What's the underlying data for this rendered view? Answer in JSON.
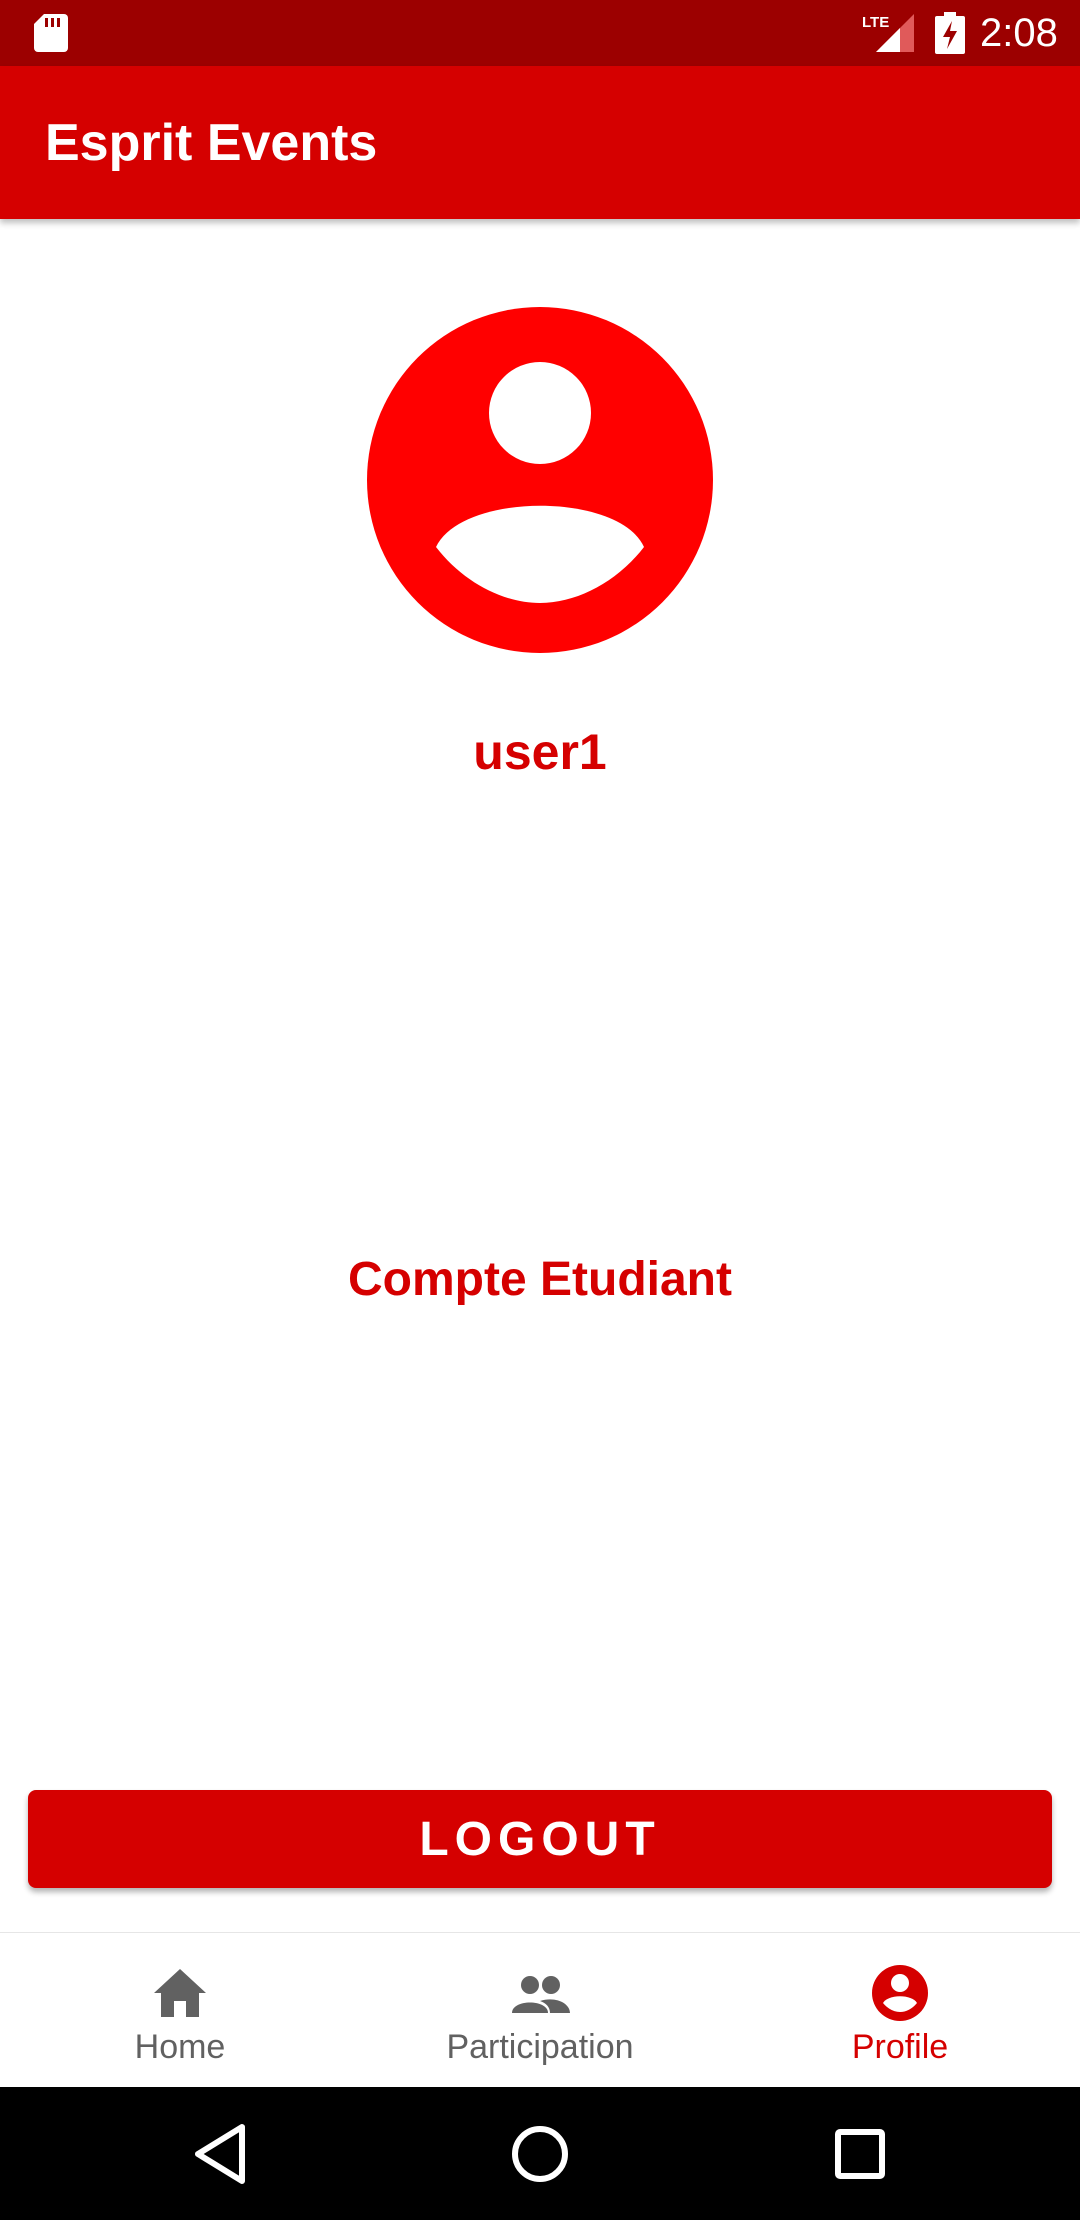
{
  "status_bar": {
    "time": "2:08",
    "network_label": "LTE",
    "icons": [
      "sd-card-icon",
      "lte-signal-icon",
      "battery-charging-icon"
    ]
  },
  "app_bar": {
    "title": "Esprit Events"
  },
  "profile": {
    "avatar_icon": "account-circle-icon",
    "username": "user1",
    "account_type": "Compte Etudiant"
  },
  "actions": {
    "logout_label": "LOGOUT"
  },
  "bottom_nav": {
    "items": [
      {
        "label": "Home",
        "icon": "home-icon",
        "active": false
      },
      {
        "label": "Participation",
        "icon": "group-icon",
        "active": false
      },
      {
        "label": "Profile",
        "icon": "account-circle-icon",
        "active": true
      }
    ]
  },
  "colors": {
    "primary": "#d50000",
    "primary_dark": "#9c0000",
    "avatar": "#ff0000",
    "inactive_nav": "#616161"
  }
}
